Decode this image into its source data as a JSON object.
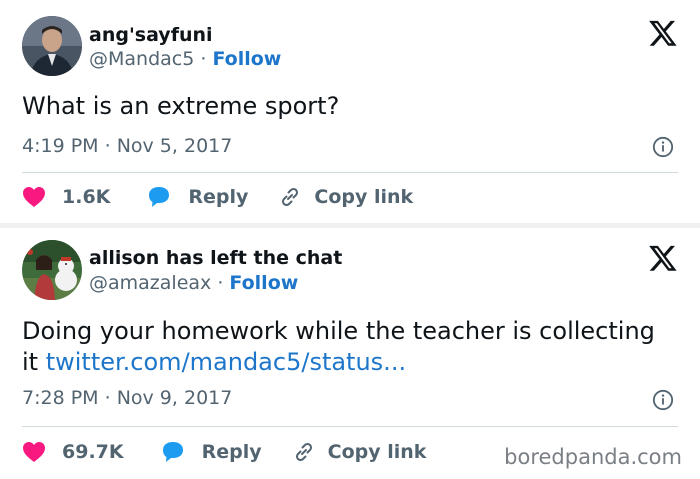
{
  "tweets": [
    {
      "name": "ang'sayfuni",
      "handle": "@Mandac5",
      "separator": " · ",
      "follow_label": "Follow",
      "text": "What is an extreme sport?",
      "link_text": "",
      "time": "4:19 PM",
      "date": "Nov 5, 2017",
      "likes": "1.6K",
      "reply_label": "Reply",
      "copy_link_label": "Copy link"
    },
    {
      "name": "allison has left the chat",
      "handle": "@amazaleax",
      "separator": " · ",
      "follow_label": "Follow",
      "text": "Doing your homework while the teacher is collecting it ",
      "link_text": "twitter.com/mandac5/status...",
      "time": "7:28 PM",
      "date": "Nov 9, 2017",
      "likes": "69.7K",
      "reply_label": "Reply",
      "copy_link_label": "Copy link"
    }
  ],
  "watermark": "boredpanda.com",
  "colors": {
    "like": "#f91880",
    "reply": "#1d9bf0",
    "link": "#1d76ca",
    "muted": "#536471"
  },
  "icons": [
    "x-logo-icon",
    "info-icon",
    "heart-icon",
    "reply-bubble-icon",
    "link-icon"
  ]
}
